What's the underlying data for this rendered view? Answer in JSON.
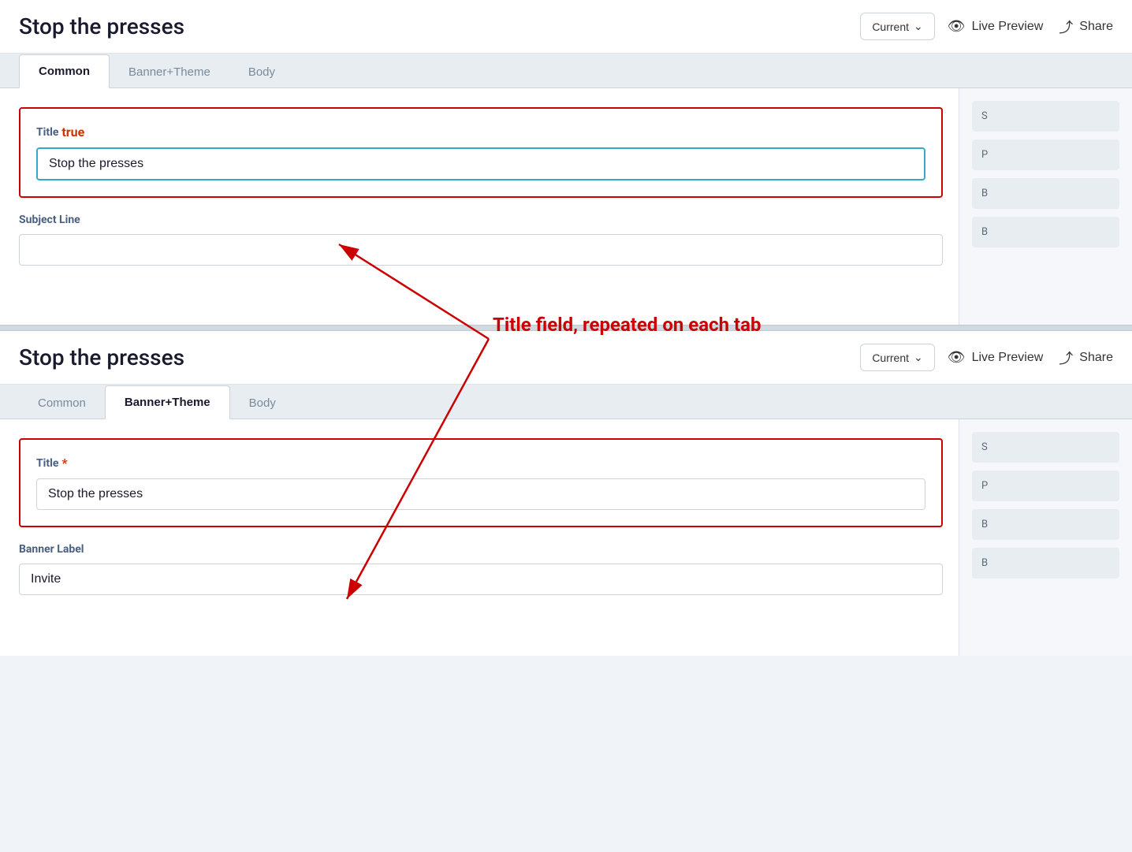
{
  "page": {
    "title": "Stop the presses",
    "dropdown_label": "Current",
    "dropdown_icon": "chevron-down",
    "live_preview_label": "Live Preview",
    "share_label": "Share"
  },
  "top_panel": {
    "tabs": [
      {
        "id": "common",
        "label": "Common",
        "active": true
      },
      {
        "id": "banner_theme",
        "label": "Banner+Theme",
        "active": false
      },
      {
        "id": "body",
        "label": "Body",
        "active": false
      }
    ],
    "title_field": {
      "label": "Title",
      "required": true,
      "value": "Stop the presses",
      "placeholder": ""
    },
    "subject_line_field": {
      "label": "Subject Line",
      "value": "",
      "placeholder": ""
    }
  },
  "bottom_panel": {
    "title": "Stop the presses",
    "dropdown_label": "Current",
    "live_preview_label": "Live Preview",
    "share_label": "Share",
    "tabs": [
      {
        "id": "common",
        "label": "Common",
        "active": false
      },
      {
        "id": "banner_theme",
        "label": "Banner+Theme",
        "active": true
      },
      {
        "id": "body",
        "label": "Body",
        "active": false
      }
    ],
    "title_field": {
      "label": "Title",
      "required": true,
      "value": "Stop the presses",
      "placeholder": ""
    },
    "banner_label_field": {
      "label": "Banner Label",
      "value": "Invite",
      "placeholder": ""
    }
  },
  "annotation": {
    "text": "Title field, repeated on each tab"
  },
  "sidebar_items": [
    {
      "label": "S"
    },
    {
      "label": "P"
    },
    {
      "label": "B"
    },
    {
      "label": "B"
    }
  ]
}
